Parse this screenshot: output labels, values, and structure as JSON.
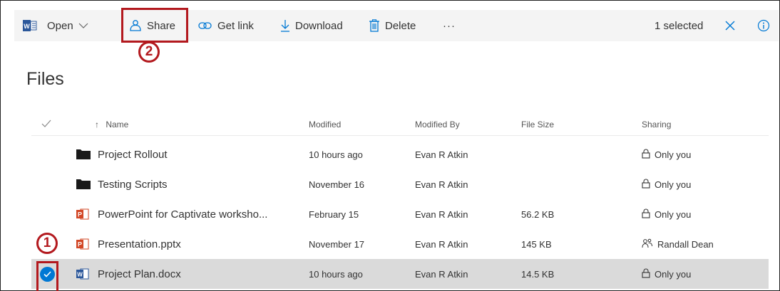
{
  "colors": {
    "accent": "#0078d4",
    "highlight": "#b3191e",
    "word_blue": "#2b579a",
    "ppt_red": "#d24726"
  },
  "toolbar": {
    "word_icon": "word-icon",
    "open_label": "Open",
    "share_label": "Share",
    "getlink_label": "Get link",
    "download_label": "Download",
    "delete_label": "Delete",
    "more_label": "···",
    "selected_label": "1 selected",
    "info_icon": "info-icon"
  },
  "callouts": {
    "one": "1",
    "two": "2"
  },
  "page": {
    "title": "Files"
  },
  "columns": {
    "name": "Name",
    "modified": "Modified",
    "modified_by": "Modified By",
    "file_size": "File Size",
    "sharing": "Sharing",
    "sort_indicator": "↑"
  },
  "files": [
    {
      "icon": "folder-icon",
      "name": "Project Rollout",
      "modified": "10 hours ago",
      "modified_by": "Evan R Atkin",
      "size": "",
      "sharing_icon": "lock-icon",
      "sharing": "Only you",
      "selected": false
    },
    {
      "icon": "folder-icon",
      "name": "Testing Scripts",
      "modified": "November 16",
      "modified_by": "Evan R Atkin",
      "size": "",
      "sharing_icon": "lock-icon",
      "sharing": "Only you",
      "selected": false
    },
    {
      "icon": "powerpoint-file-icon",
      "name": "PowerPoint for Captivate worksho...",
      "modified": "February 15",
      "modified_by": "Evan R Atkin",
      "size": "56.2 KB",
      "sharing_icon": "lock-icon",
      "sharing": "Only you",
      "selected": false
    },
    {
      "icon": "powerpoint-file-icon",
      "name": "Presentation.pptx",
      "modified": "November 17",
      "modified_by": "Evan R Atkin",
      "size": "145 KB",
      "sharing_icon": "people-icon",
      "sharing": "Randall Dean",
      "selected": false
    },
    {
      "icon": "word-file-icon",
      "name": "Project Plan.docx",
      "modified": "10 hours ago",
      "modified_by": "Evan R Atkin",
      "size": "14.5 KB",
      "sharing_icon": "lock-icon",
      "sharing": "Only you",
      "selected": true
    }
  ]
}
